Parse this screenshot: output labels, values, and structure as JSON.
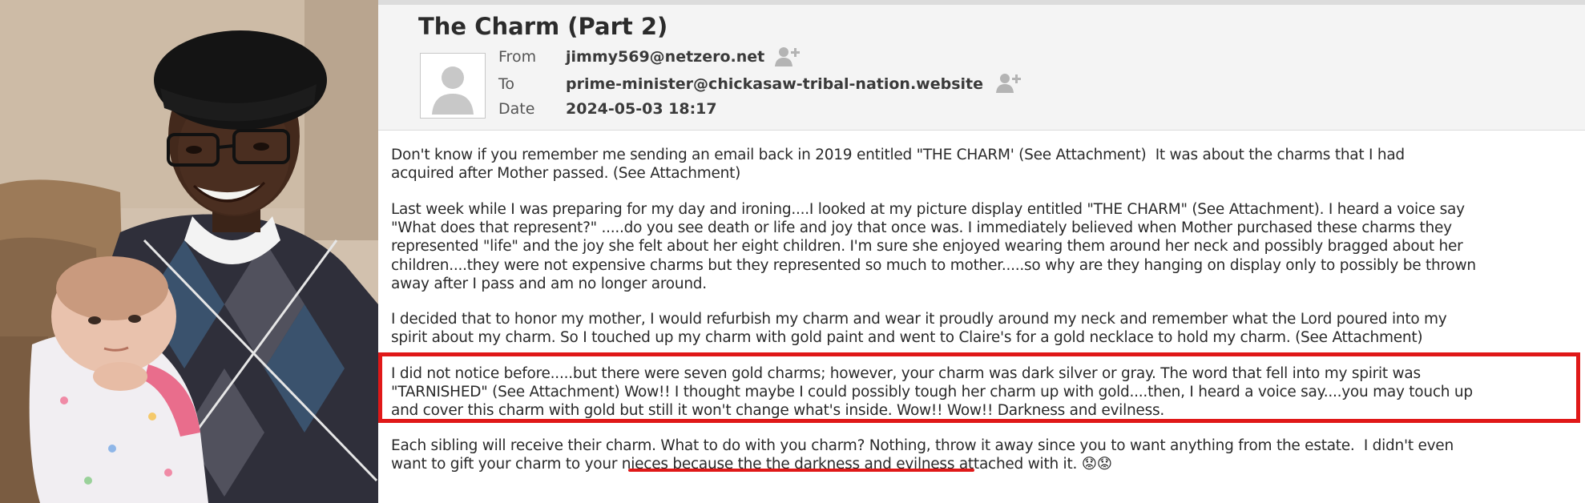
{
  "email": {
    "subject": "The Charm (Part 2)",
    "from_label": "From",
    "from_value": "jimmy569@netzero.net",
    "to_label": "To",
    "to_value": "prime-minister@chickasaw-tribal-nation.website",
    "date_label": "Date",
    "date_value": "2024-05-03 18:17",
    "body": {
      "p1": "Don't know if you remember me sending an email back in 2019 entitled \"THE CHARM' (See Attachment)  It was about the charms that I had\nacquired after Mother passed. (See Attachment)",
      "p2": "Last week while I was preparing for my day and ironing....I looked at my picture display entitled \"THE CHARM\" (See Attachment). I heard a voice say\n\"What does that represent?\" .....do you see death or life and joy that once was. I immediately believed when Mother purchased these charms they\nrepresented \"life\" and the joy she felt about her eight children. I'm sure she enjoyed wearing them around her neck and possibly bragged about her\nchildren....they were not expensive charms but they represented so much to mother.....so why are they hanging on display only to possibly be thrown\naway after I pass and am no longer around.",
      "p3": "I decided that to honor my mother, I would refurbish my charm and wear it proudly around my neck and remember what the Lord poured into my\nspirit about my charm. So I touched up my charm with gold paint and went to Claire's for a gold necklace to hold my charm. (See Attachment)",
      "p4": "I did not notice before.....but there were seven gold charms; however, your charm was dark silver or gray. The word that fell into my spirit was\n\"TARNISHED\" (See Attachment) Wow!! I thought maybe I could possibly tough her charm up with gold....then, I heard a voice say....you may touch up\nand cover this charm with gold but still it won't change what's inside. Wow!! Wow!! Darkness and evilness.",
      "p5": "Each sibling will receive their charm. What to do with you charm? Nothing, throw it away since you to want anything from the estate.  I didn't even\nwant to gift your charm to your nieces because the the darkness and evilness attached with it. 😟😟"
    }
  },
  "colors": {
    "annotation_red": "#e01818",
    "header_bg": "#f4f4f4"
  }
}
